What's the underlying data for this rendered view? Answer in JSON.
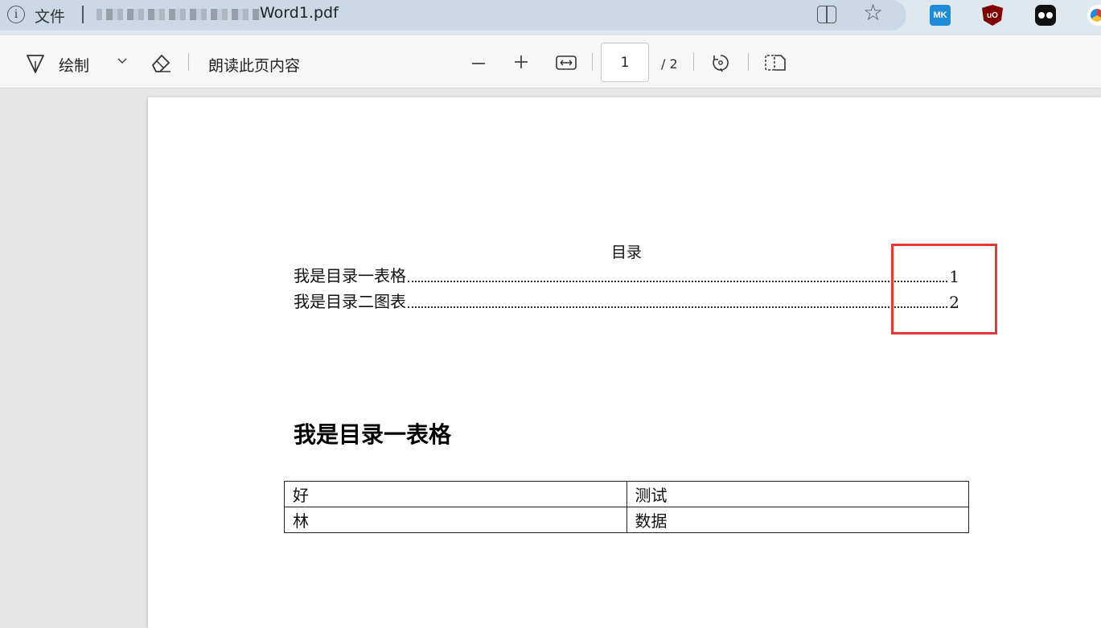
{
  "address_bar": {
    "info_icon": "info-icon",
    "file_label": "文件",
    "url_suffix": "Word1.pdf"
  },
  "toolbar": {
    "draw_label": "绘制",
    "read_aloud_label": "朗读此页内容",
    "current_page": "1",
    "total_pages": "/ 2"
  },
  "document": {
    "toc_title": "目录",
    "toc_entries": [
      {
        "label": "我是目录一表格",
        "page": "1"
      },
      {
        "label": "我是目录二图表",
        "page": "2"
      }
    ],
    "heading": "我是目录一表格",
    "table": [
      [
        "好",
        "测试"
      ],
      [
        "林",
        "数据"
      ]
    ]
  },
  "colors": {
    "highlight_border": "#e53935",
    "address_bar_bg": "#cbd9e4",
    "toolbar_bg": "#f7f7f7"
  }
}
